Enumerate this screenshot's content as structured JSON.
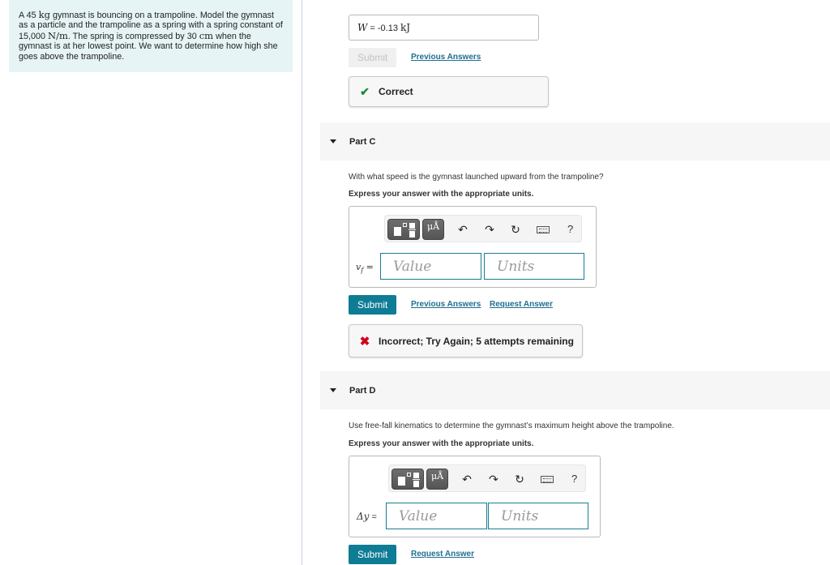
{
  "problem": {
    "parts": [
      {
        "t": "A 45 "
      },
      {
        "m": "kg"
      },
      {
        "t": " gymnast is bouncing on a trampoline. Model the gymnast as a particle and the trampoline as a spring with a spring constant of 15,000 "
      },
      {
        "m": "N/m"
      },
      {
        "t": ". The spring is compressed by 30 "
      },
      {
        "m": "cm"
      },
      {
        "t": " when the gymnast is at her lowest point. We want to determine how high she goes above the trampoline."
      }
    ]
  },
  "part_b": {
    "answer_var": "W",
    "answer_eq": " = ",
    "answer_value": " -0.13 ",
    "answer_unit": "kJ",
    "submit_label": "Submit",
    "previous_answers_label": "Previous Answers",
    "feedback": "Correct",
    "feedback_icon": "✔"
  },
  "part_c": {
    "title": "Part C",
    "question": "With what speed is the gymnast launched upward from the trampoline?",
    "instruction": "Express your answer with the appropriate units.",
    "toolbar": {
      "symbols_label": "μÅ",
      "undo": "↶",
      "redo": "↷",
      "reset": "↻",
      "help": "?"
    },
    "var_label": "v",
    "var_sub": "f",
    "var_eq": " =",
    "value_placeholder": "Value",
    "units_placeholder": "Units",
    "submit_label": "Submit",
    "previous_answers_label": "Previous Answers",
    "request_answer_label": "Request Answer",
    "feedback": "Incorrect; Try Again; 5 attempts remaining",
    "feedback_icon": "✖"
  },
  "part_d": {
    "title": "Part D",
    "question": "Use free-fall kinematics to determine the gymnast’s maximum height above the trampoline.",
    "instruction": "Express your answer with the appropriate units.",
    "toolbar": {
      "symbols_label": "μÅ",
      "undo": "↶",
      "redo": "↷",
      "reset": "↻",
      "help": "?"
    },
    "var_label": "Δy",
    "var_eq": " =",
    "value_placeholder": "Value",
    "units_placeholder": "Units",
    "submit_label": "Submit",
    "request_answer_label": "Request Answer"
  },
  "colors": {
    "accent": "#0e7c95",
    "link": "#1f6f8f",
    "correct": "#1d8a3a",
    "incorrect": "#d0021b",
    "problem_bg": "#e6f4f5"
  }
}
